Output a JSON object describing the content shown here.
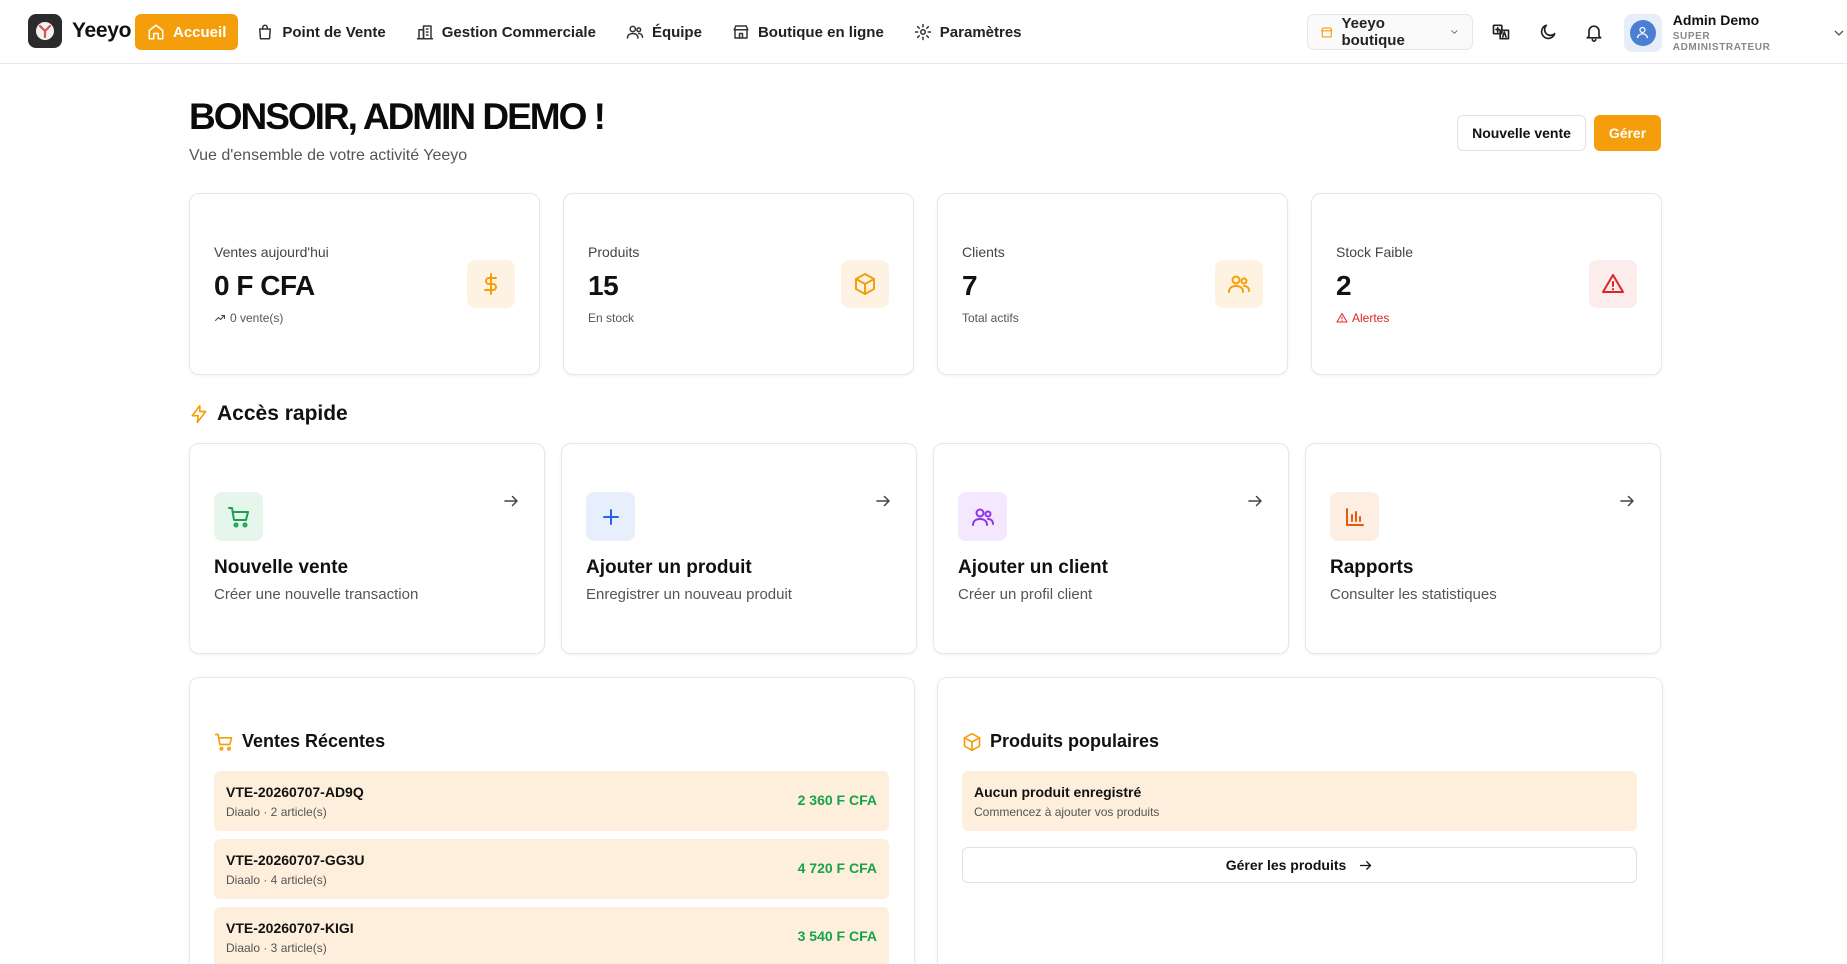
{
  "app": {
    "name": "Yeeyo"
  },
  "nav": [
    {
      "label": "Accueil",
      "icon": "home-icon",
      "active": true
    },
    {
      "label": "Point de Vente",
      "icon": "shopping-bag-icon"
    },
    {
      "label": "Gestion Commerciale",
      "icon": "building-icon"
    },
    {
      "label": "Équipe",
      "icon": "users-icon"
    },
    {
      "label": "Boutique en ligne",
      "icon": "store-icon"
    },
    {
      "label": "Paramètres",
      "icon": "gear-icon"
    }
  ],
  "shop_selector": {
    "value": "Yeeyo boutique"
  },
  "user": {
    "name": "Admin Demo",
    "role": "SUPER ADMINISTRATEUR"
  },
  "header": {
    "greeting": "BONSOIR, ADMIN DEMO !",
    "subtitle": "Vue d'ensemble de votre activité Yeeyo",
    "new_sale_label": "Nouvelle vente",
    "manage_label": "Gérer"
  },
  "stats": [
    {
      "label": "Ventes aujourd'hui",
      "value": "0 F CFA",
      "sub": "0 vente(s)",
      "icon": "dollar-icon",
      "color": "#f59e0b",
      "bg": "#fef3e2"
    },
    {
      "label": "Produits",
      "value": "15",
      "sub": "En stock",
      "icon": "box-icon",
      "color": "#f59e0b",
      "bg": "#fef3e2"
    },
    {
      "label": "Clients",
      "value": "7",
      "sub": "Total actifs",
      "icon": "users-icon",
      "color": "#f59e0b",
      "bg": "#fef3e2"
    },
    {
      "label": "Stock Faible",
      "value": "2",
      "sub": "Alertes",
      "icon": "alert-triangle-icon",
      "color": "#dc2626",
      "bg": "#fdecec"
    }
  ],
  "quick_access": {
    "title": "Accès rapide",
    "items": [
      {
        "title": "Nouvelle vente",
        "desc": "Créer une nouvelle transaction",
        "icon": "cart-icon",
        "color": "#16a34a",
        "bg": "#e6f6ec"
      },
      {
        "title": "Ajouter un produit",
        "desc": "Enregistrer un nouveau produit",
        "icon": "plus-icon",
        "color": "#2563eb",
        "bg": "#e8effc"
      },
      {
        "title": "Ajouter un client",
        "desc": "Créer un profil client",
        "icon": "users-icon",
        "color": "#9333ea",
        "bg": "#f3e8fd"
      },
      {
        "title": "Rapports",
        "desc": "Consulter les statistiques",
        "icon": "bar-chart-icon",
        "color": "#ea580c",
        "bg": "#fdeee4"
      }
    ]
  },
  "recent_sales": {
    "title": "Ventes Récentes",
    "rows": [
      {
        "ref": "VTE-20260707-AD9Q",
        "meta": "Diaalo · 2 article(s)",
        "amount": "2 360 F CFA"
      },
      {
        "ref": "VTE-20260707-GG3U",
        "meta": "Diaalo · 4 article(s)",
        "amount": "4 720 F CFA"
      },
      {
        "ref": "VTE-20260707-KIGI",
        "meta": "Diaalo · 3 article(s)",
        "amount": "3 540 F CFA"
      }
    ]
  },
  "popular_products": {
    "title": "Produits populaires",
    "empty_title": "Aucun produit enregistré",
    "empty_sub": "Commencez à ajouter vos produits",
    "manage_label": "Gérer les produits"
  }
}
